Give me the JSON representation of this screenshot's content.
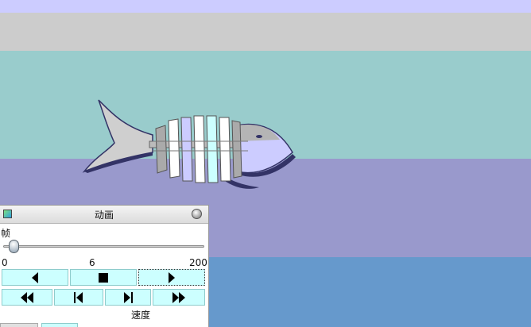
{
  "scene": {
    "colors": {
      "band_lavender": "#ccccff",
      "band_gray": "#cccccc",
      "band_teal": "#99cccc",
      "band_purple": "#9999cc",
      "band_blue": "#6699cc"
    }
  },
  "panel": {
    "title": "动画",
    "frame_label": "帧",
    "slider": {
      "min_label": "0",
      "value_label": "6",
      "max_label": "200",
      "value": 6,
      "min": 0,
      "max": 200
    },
    "speed_label": "速度",
    "buttons": {
      "rewind": "step-back-icon",
      "stop": "stop-icon",
      "play": "play-icon",
      "fast_rewind": "fast-rewind-icon",
      "to_start": "skip-to-start-icon",
      "to_end": "skip-to-end-icon",
      "fast_forward": "fast-forward-icon"
    },
    "accent": "#ccffff"
  }
}
